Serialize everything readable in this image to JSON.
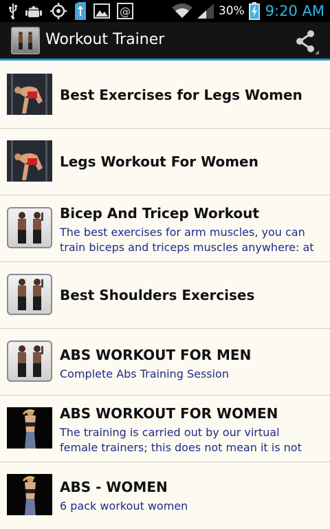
{
  "status_bar": {
    "battery_percent": "30%",
    "time": "9:20 AM",
    "icons": [
      "usb-icon",
      "android-debug-icon",
      "gps-icon",
      "sd-card-icon",
      "gallery-icon",
      "email-icon",
      "wifi-icon",
      "signal-icon",
      "battery-charging-icon"
    ]
  },
  "action_bar": {
    "title": "Workout Trainer",
    "share_icon": "share-icon"
  },
  "colors": {
    "accent": "#1f8fc4",
    "time": "#33b5e5",
    "subtitle": "#1e2a8a",
    "list_bg": "#fdfaf2"
  },
  "items": [
    {
      "title": "Best Exercises for Legs Women",
      "subtitle": "",
      "thumb": "gym"
    },
    {
      "title": "Legs Workout For Women",
      "subtitle": "",
      "thumb": "gym"
    },
    {
      "title": "Bicep And Tricep Workout",
      "subtitle": "The best exercises for arm muscles, you can\ntrain biceps and triceps muscles anywhere: at",
      "thumb": "men"
    },
    {
      "title": "Best Shoulders Exercises",
      "subtitle": "",
      "thumb": "men"
    },
    {
      "title": "ABS WORKOUT FOR MEN",
      "subtitle": "Complete Abs Training Session",
      "thumb": "men"
    },
    {
      "title": "ABS WORKOUT FOR WOMEN",
      "subtitle": "The training is carried out by our virtual\nfemale trainers; this does not mean it is not",
      "thumb": "dark"
    },
    {
      "title": "ABS - WOMEN",
      "subtitle": "6 pack workout women",
      "thumb": "dark"
    }
  ]
}
